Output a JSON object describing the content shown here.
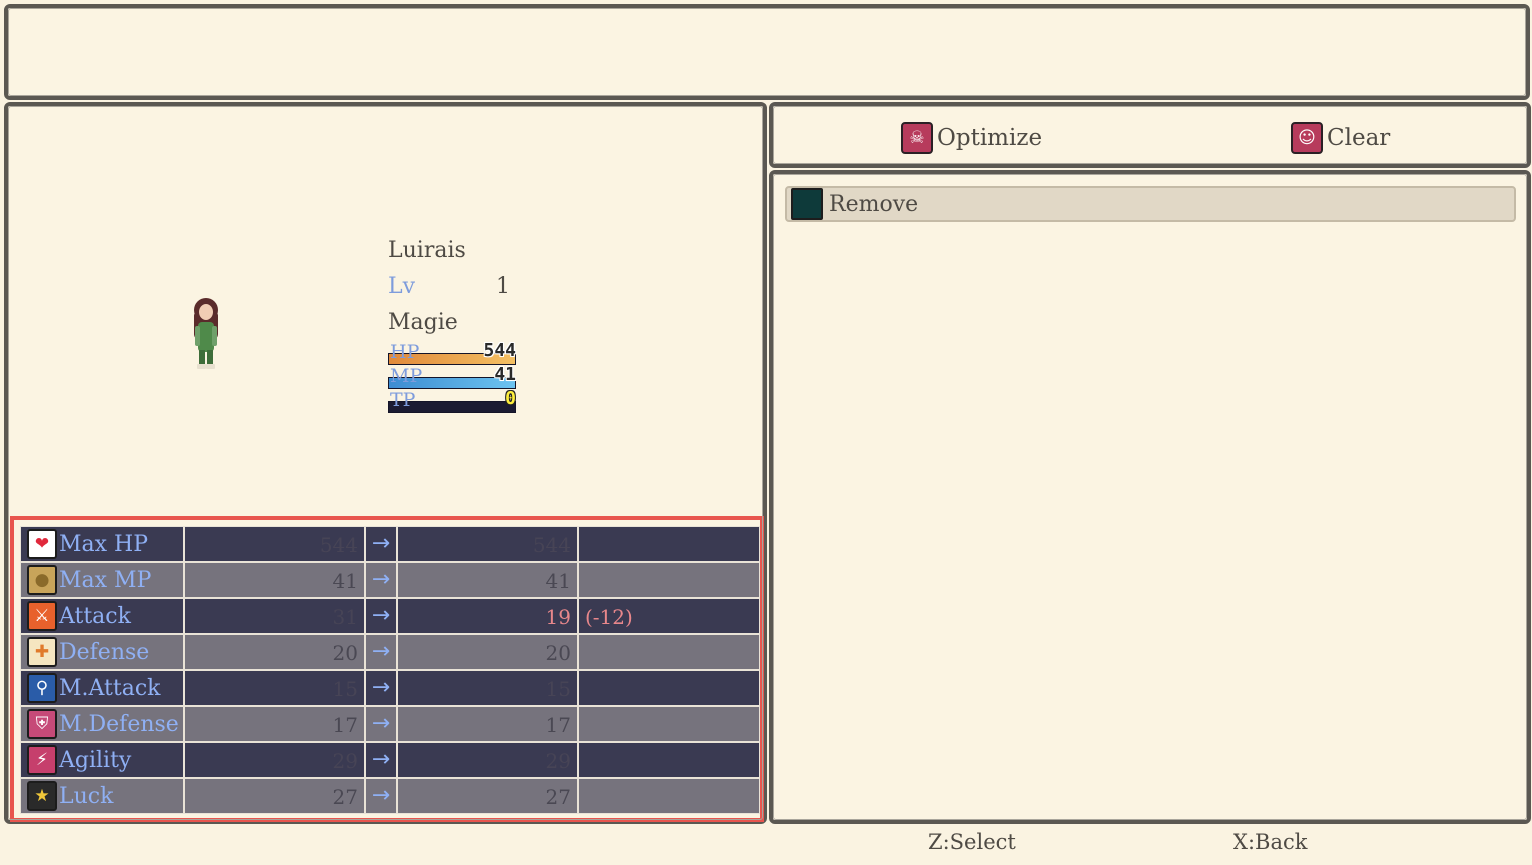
{
  "help": {
    "text": ""
  },
  "commands": [
    {
      "label": "Optimize",
      "icon": "optimize-icon",
      "glyph": "☠",
      "color": "#b73b5c"
    },
    {
      "label": "Clear",
      "icon": "clear-icon",
      "glyph": "☺",
      "color": "#b73b5c"
    }
  ],
  "items": [
    {
      "label": "Remove",
      "icon": "empty-slot-icon"
    }
  ],
  "actor": {
    "name": "Luirais",
    "level_label": "Lv",
    "level": "1",
    "class": "Magie",
    "gauges": [
      {
        "label": "HP",
        "value": "544",
        "fill": 1.0,
        "color": "linear-gradient(90deg,#e0893a,#f4c063)"
      },
      {
        "label": "MP",
        "value": "41",
        "fill": 1.0,
        "color": "linear-gradient(90deg,#3d8cd1,#6cc3f0)"
      },
      {
        "label": "TP",
        "value": "0",
        "fill": 0.0,
        "color": "#2a7a36"
      }
    ]
  },
  "stats": [
    {
      "name": "Max HP",
      "icon": "heart-icon",
      "glyph": "❤",
      "icon_bg": "#ffffff",
      "icon_fg": "#e0283c",
      "current": "544",
      "arrow": "→",
      "new": "544",
      "diff": "",
      "down": false
    },
    {
      "name": "Max MP",
      "icon": "orb-icon",
      "glyph": "●",
      "icon_bg": "#c8a45a",
      "icon_fg": "#8a6a2a",
      "current": "41",
      "arrow": "→",
      "new": "41",
      "diff": "",
      "down": false
    },
    {
      "name": "Attack",
      "icon": "sword-icon",
      "glyph": "⚔",
      "icon_bg": "#e8612c",
      "icon_fg": "#ffffff",
      "current": "31",
      "arrow": "→",
      "new": "19",
      "diff": "(-12)",
      "down": true
    },
    {
      "name": "Defense",
      "icon": "shield-icon",
      "glyph": "✚",
      "icon_bg": "#f5e6c0",
      "icon_fg": "#e07a2a",
      "current": "20",
      "arrow": "→",
      "new": "20",
      "diff": "",
      "down": false
    },
    {
      "name": "M.Attack",
      "icon": "wand-icon",
      "glyph": "⚲",
      "icon_bg": "#2a5ca8",
      "icon_fg": "#ffffff",
      "current": "15",
      "arrow": "→",
      "new": "15",
      "diff": "",
      "down": false
    },
    {
      "name": "M.Defense",
      "icon": "magic-shield-icon",
      "glyph": "⛨",
      "icon_bg": "#c64a78",
      "icon_fg": "#ffffff",
      "current": "17",
      "arrow": "→",
      "new": "17",
      "diff": "",
      "down": false
    },
    {
      "name": "Agility",
      "icon": "boot-icon",
      "glyph": "⚡",
      "icon_bg": "#c63f6c",
      "icon_fg": "#ffffff",
      "current": "29",
      "arrow": "→",
      "new": "29",
      "diff": "",
      "down": false
    },
    {
      "name": "Luck",
      "icon": "stars-icon",
      "glyph": "★",
      "icon_bg": "#2a2a2a",
      "icon_fg": "#f0c73a",
      "current": "27",
      "arrow": "→",
      "new": "27",
      "diff": "",
      "down": false
    }
  ],
  "footer": {
    "select": "Z:Select",
    "back": "X:Back"
  }
}
